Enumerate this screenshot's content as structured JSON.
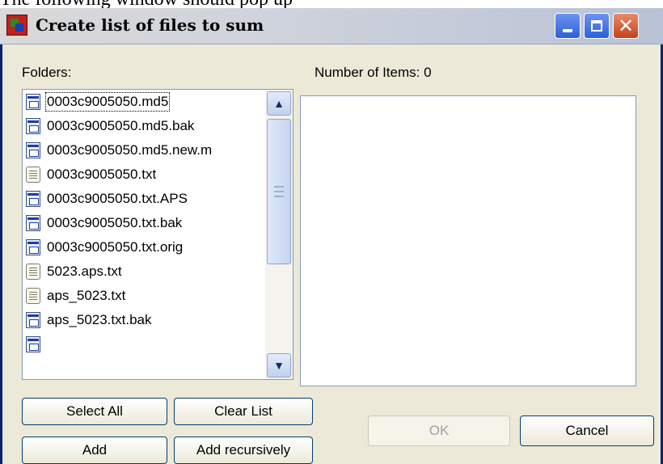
{
  "caption": "The following window should pop up",
  "window": {
    "title": "Create list of files to sum",
    "icon": "app-icon",
    "controls": [
      "minimize-icon",
      "maximize-icon",
      "close-icon"
    ]
  },
  "folders": {
    "label": "Folders:",
    "items": [
      {
        "name": "0003c9005050.md5",
        "icon": "file-icon"
      },
      {
        "name": "0003c9005050.md5.bak",
        "icon": "file-icon"
      },
      {
        "name": "0003c9005050.md5.new.m",
        "icon": "file-icon"
      },
      {
        "name": "0003c9005050.txt",
        "icon": "text-file-icon"
      },
      {
        "name": "0003c9005050.txt.APS",
        "icon": "file-icon"
      },
      {
        "name": "0003c9005050.txt.bak",
        "icon": "file-icon"
      },
      {
        "name": "0003c9005050.txt.orig",
        "icon": "file-icon"
      },
      {
        "name": "5023.aps.txt",
        "icon": "text-file-icon"
      },
      {
        "name": "aps_5023.txt",
        "icon": "text-file-icon"
      },
      {
        "name": "aps_5023.txt.bak",
        "icon": "file-icon"
      },
      {
        "name": "",
        "icon": "file-icon"
      }
    ]
  },
  "selected": {
    "count_label": "Number of Items: 0",
    "items": []
  },
  "buttons": {
    "select_all": "Select All",
    "clear_list": "Clear List",
    "add": "Add",
    "add_recursively": "Add recursively",
    "ok": "OK",
    "cancel": "Cancel"
  },
  "colors": {
    "titlebar": "#cfd3dc",
    "close_button": "#c4421c",
    "window_frame": "#0a246a",
    "dialog_bg": "#ece9d8"
  }
}
